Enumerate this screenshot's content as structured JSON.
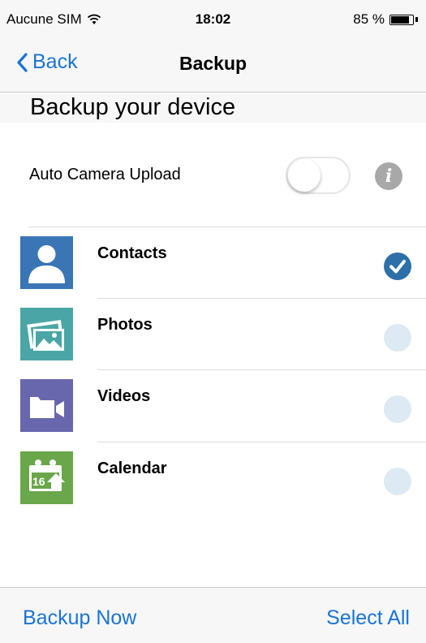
{
  "status_bar": {
    "carrier": "Aucune SIM",
    "time": "18:02",
    "battery": "85 %",
    "battery_level": 0.85,
    "wifi_icon": "wifi-icon"
  },
  "nav": {
    "back_label": "Back",
    "title": "Backup"
  },
  "section": {
    "title": "Backup your device"
  },
  "auto_upload": {
    "label": "Auto Camera Upload",
    "enabled": false
  },
  "items": [
    {
      "label": "Contacts",
      "icon": "contacts-icon",
      "color": "#3a75b6",
      "checked": true
    },
    {
      "label": "Photos",
      "icon": "photos-icon",
      "color": "#4aa6a6",
      "checked": false
    },
    {
      "label": "Videos",
      "icon": "videos-icon",
      "color": "#6867ad",
      "checked": false
    },
    {
      "label": "Calendar",
      "icon": "calendar-icon",
      "color": "#6aa64a",
      "checked": false,
      "icon_text": "16"
    }
  ],
  "footer": {
    "backup_now": "Backup Now",
    "select_all": "Select All"
  },
  "colors": {
    "accent": "#1a74d6",
    "check_on": "#2d6fa8",
    "check_off": "#dde9f3"
  }
}
